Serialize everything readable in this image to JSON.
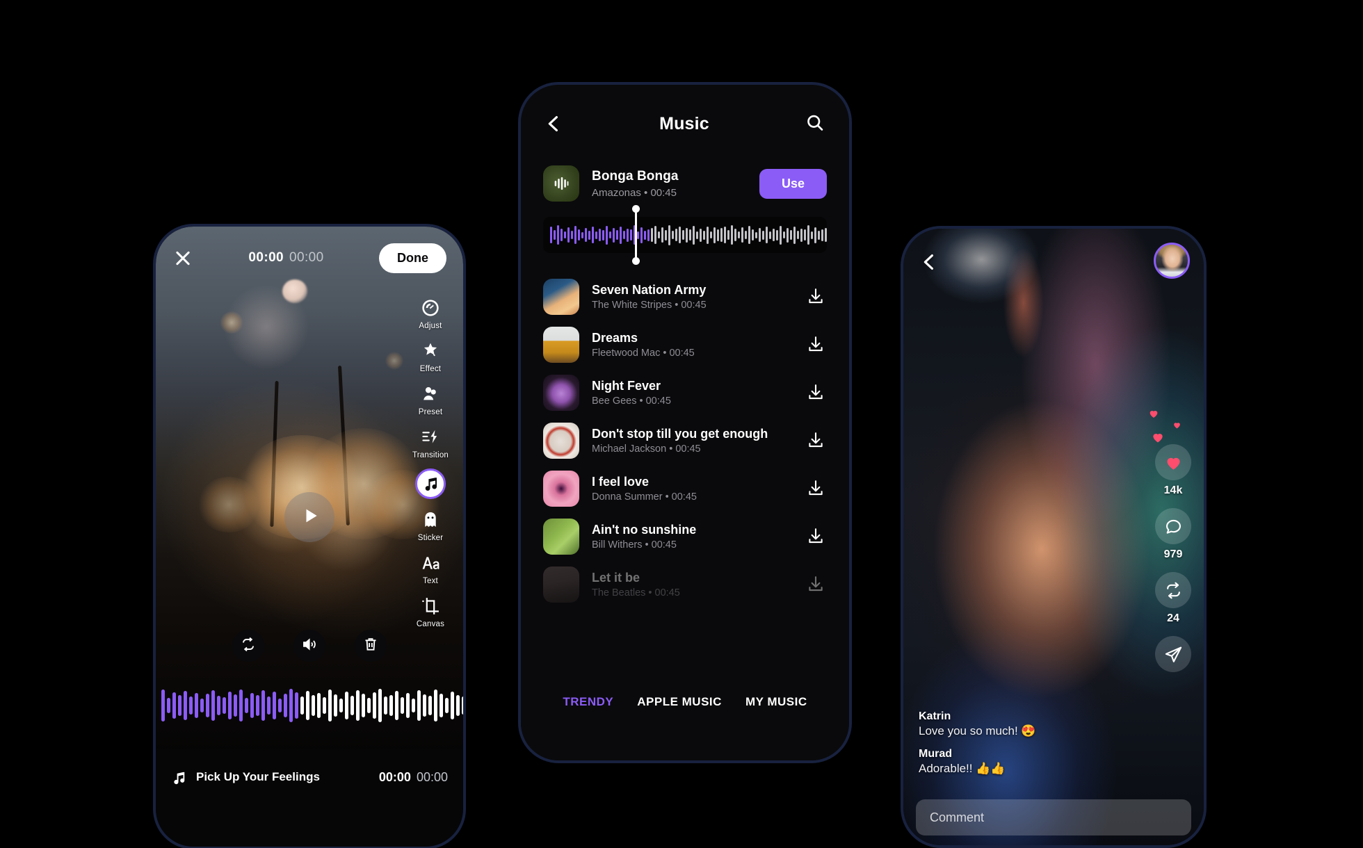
{
  "editor": {
    "close_icon": "close-icon",
    "time_current": "00:00",
    "time_total": "00:00",
    "done_label": "Done",
    "tools": [
      {
        "label": "Adjust",
        "icon": "adjust-dial-icon",
        "active": false
      },
      {
        "label": "Effect",
        "icon": "magic-wand-star-icon",
        "active": false
      },
      {
        "label": "Preset",
        "icon": "preset-circles-icon",
        "active": false
      },
      {
        "label": "Transition",
        "icon": "transition-lightning-icon",
        "active": false
      },
      {
        "label": "",
        "icon": "music-note-icon",
        "active": true
      },
      {
        "label": "Sticker",
        "icon": "ghost-sticker-icon",
        "active": false
      },
      {
        "label": "Text",
        "icon": "text-aa-icon",
        "active": false
      },
      {
        "label": "Canvas",
        "icon": "crop-canvas-icon",
        "active": false
      }
    ],
    "play_icon": "play-icon",
    "audio_actions": [
      {
        "icon": "loop-repeat-icon",
        "name": "loop-button"
      },
      {
        "icon": "volume-icon",
        "name": "volume-button"
      },
      {
        "icon": "trash-icon",
        "name": "delete-button"
      }
    ],
    "now_playing": {
      "icon": "music-note-icon",
      "title": "Pick Up Your Feelings",
      "time_current": "00:00",
      "time_total": "00:00"
    }
  },
  "music": {
    "back_icon": "chevron-left-icon",
    "title": "Music",
    "search_icon": "search-icon",
    "selected": {
      "art": "waveform-album-icon",
      "name": "Bonga Bonga",
      "subtitle": "Amazonas • 00:45",
      "use_label": "Use"
    },
    "songs": [
      {
        "name": "Seven Nation Army",
        "subtitle": "The White Stripes • 00:45",
        "art": "a1",
        "download_icon": "download-icon",
        "faded": false
      },
      {
        "name": "Dreams",
        "subtitle": "Fleetwood Mac • 00:45",
        "art": "a2",
        "download_icon": "download-icon",
        "faded": false
      },
      {
        "name": "Night Fever",
        "subtitle": "Bee Gees • 00:45",
        "art": "a3",
        "download_icon": "download-icon",
        "faded": false
      },
      {
        "name": "Don't stop till you get enough",
        "subtitle": "Michael Jackson • 00:45",
        "art": "a4",
        "download_icon": "download-icon",
        "faded": false
      },
      {
        "name": "I feel love",
        "subtitle": "Donna Summer • 00:45",
        "art": "a5",
        "download_icon": "download-icon",
        "faded": false
      },
      {
        "name": "Ain't no sunshine",
        "subtitle": "Bill Withers • 00:45",
        "art": "a6",
        "download_icon": "download-icon",
        "faded": false
      },
      {
        "name": "Let it be",
        "subtitle": "The Beatles • 00:45",
        "art": "a7",
        "download_icon": "download-icon",
        "faded": true
      }
    ],
    "tabs": [
      {
        "label": "TRENDY",
        "active": true
      },
      {
        "label": "APPLE MUSIC",
        "active": false
      },
      {
        "label": "MY MUSIC",
        "active": false
      }
    ]
  },
  "social": {
    "back_icon": "chevron-left-icon",
    "avatar": "user-avatar",
    "actions": [
      {
        "icon": "heart-icon",
        "count": "14k",
        "name": "like-button"
      },
      {
        "icon": "comment-bubble-icon",
        "count": "979",
        "name": "comment-button"
      },
      {
        "icon": "repost-loop-icon",
        "count": "24",
        "name": "repost-button"
      },
      {
        "icon": "send-paper-plane-icon",
        "count": "",
        "name": "share-button"
      }
    ],
    "comments": [
      {
        "user": "Katrin",
        "text": "Love you so much! 😍"
      },
      {
        "user": "Murad",
        "text": "Adorable!! 👍👍"
      }
    ],
    "comment_placeholder": "Comment",
    "comment_value": ""
  },
  "colors": {
    "accent_purple": "#8b5cf6",
    "frame_navy": "#18223f",
    "heart_red": "#ff4d6d",
    "background": "#000000"
  }
}
